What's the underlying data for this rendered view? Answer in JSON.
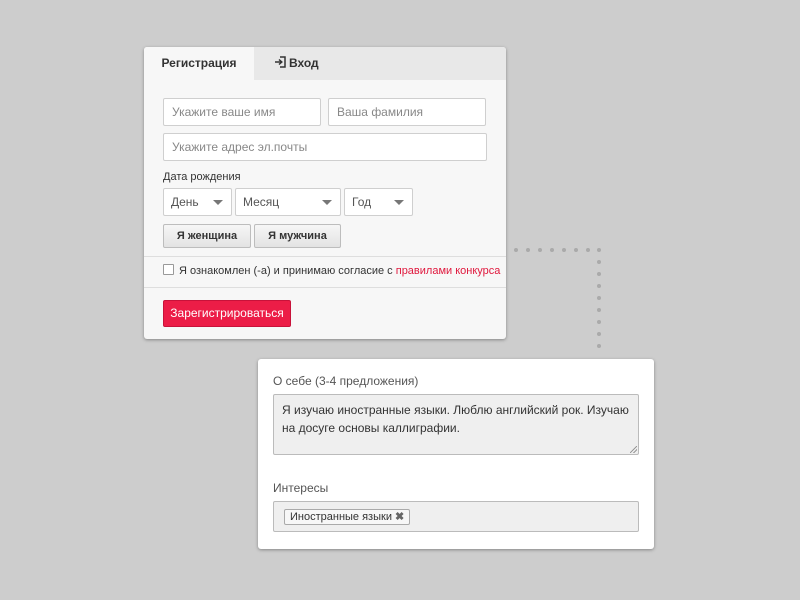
{
  "tabs": {
    "register": "Регистрация",
    "login": "Вход",
    "login_icon": "login-arrow-icon"
  },
  "form": {
    "first_name": {
      "placeholder": "Укажите ваше имя",
      "value": ""
    },
    "last_name": {
      "placeholder": "Ваша фамилия",
      "value": ""
    },
    "email": {
      "placeholder": "Укажите адрес эл.почты",
      "value": ""
    },
    "dob_label": "Дата рождения",
    "day": "День",
    "month": "Месяц",
    "year": "Год",
    "female_button": "Я женщина",
    "male_button": "Я мужчина",
    "agree_text": "Я ознакомлен (-а) и принимаю согласие с ",
    "rules_link": "правилами конкурса",
    "submit_button": "Зарегистрироваться"
  },
  "about": {
    "label": "О себе (3-4 предложения)",
    "text": "Я изучаю иностранные языки. Люблю английский рок. Изучаю на досуге основы каллиграфии.",
    "interests_label": "Интересы",
    "tags": [
      "Иностранные языки"
    ]
  },
  "colors": {
    "accent": "#ec1d47",
    "link": "#e0183d",
    "background": "#cdcdcd"
  }
}
